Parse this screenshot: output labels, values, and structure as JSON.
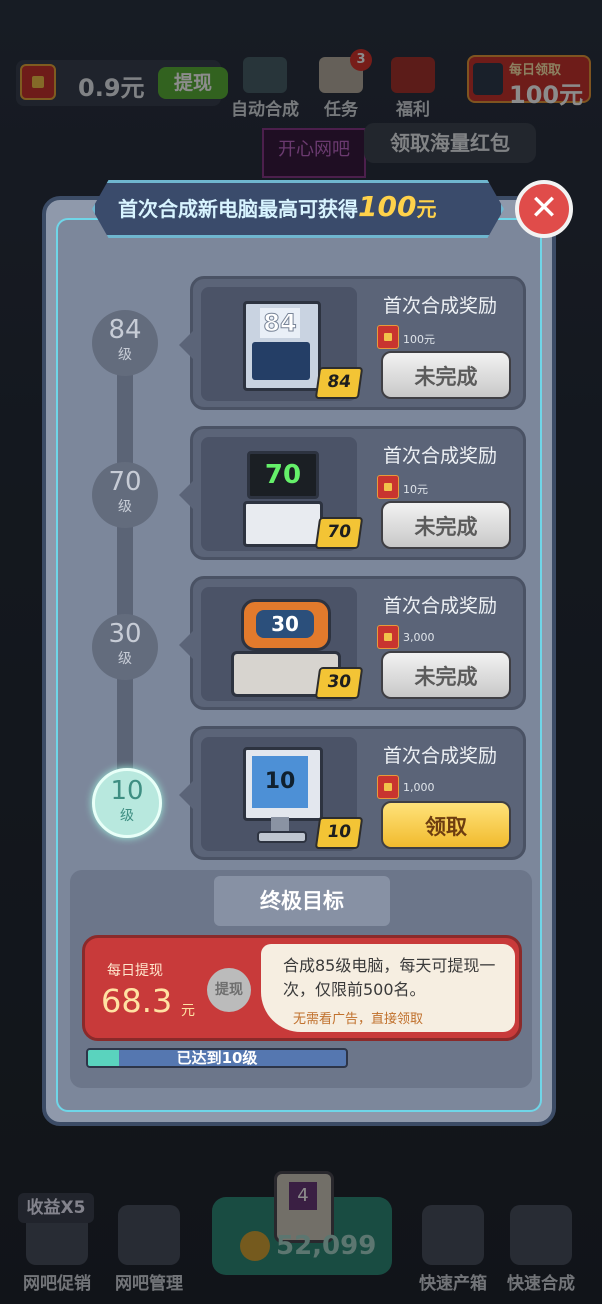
{
  "topbar": {
    "cash": "0.9元",
    "withdraw": "提现",
    "auto_merge": "自动合成",
    "tasks": "任务",
    "tasks_badge": "3",
    "welfare": "福利",
    "daily_line1": "每日领取",
    "daily_line2": "100元",
    "tooltip": "领取海量红包",
    "neon": "开心网吧"
  },
  "modal": {
    "banner_prefix": "首次合成新电脑最高可获得",
    "banner_amount": "100",
    "banner_suffix": "元",
    "close": "✕",
    "levels": [
      {
        "num": "84",
        "unit": "级"
      },
      {
        "num": "70",
        "unit": "级"
      },
      {
        "num": "30",
        "unit": "级"
      },
      {
        "num": "10",
        "unit": "级"
      }
    ],
    "cards": [
      {
        "title": "首次合成奖励",
        "reward": "100元",
        "tag": "84",
        "screen": "84",
        "button": "未完成"
      },
      {
        "title": "首次合成奖励",
        "reward": "10元",
        "tag": "70",
        "screen": "70",
        "button": "未完成"
      },
      {
        "title": "首次合成奖励",
        "reward": "3,000",
        "tag": "30",
        "screen": "30",
        "button": "未完成"
      },
      {
        "title": "首次合成奖励",
        "reward": "1,000",
        "tag": "10",
        "screen": "10",
        "button": "领取"
      }
    ],
    "goal": {
      "title": "终极目标",
      "label": "每日提现",
      "amount": "68.3",
      "unit": "元",
      "withdraw": "提现",
      "desc": "合成85级电脑，每天可提现一次，仅限前500名。",
      "note": "无需看广告，直接领取",
      "progress_text": "已达到10级",
      "progress_fraction": 0.12
    }
  },
  "bottombar": {
    "sale_badge": "收益X5",
    "promo": "网吧促销",
    "manage": "网吧管理",
    "coins": "52,099",
    "pc_level": "4",
    "box": "快速产箱",
    "merge": "快速合成"
  },
  "colors": {
    "accent_red": "#c8342f",
    "gold": "#f1bb2e",
    "teal": "#6fd6e8"
  }
}
